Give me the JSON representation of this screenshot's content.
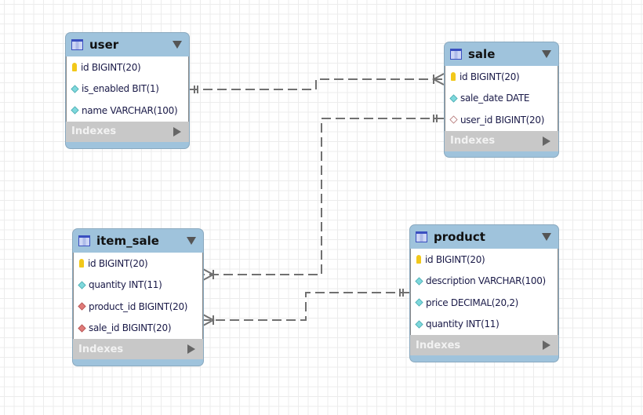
{
  "tables": {
    "user": {
      "name": "user",
      "indexes_label": "Indexes",
      "columns": [
        {
          "text": "id BIGINT(20)",
          "icon": "primary-key-icon"
        },
        {
          "text": "is_enabled BIT(1)",
          "icon": "column-icon"
        },
        {
          "text": "name VARCHAR(100)",
          "icon": "column-icon"
        }
      ]
    },
    "sale": {
      "name": "sale",
      "indexes_label": "Indexes",
      "columns": [
        {
          "text": "id BIGINT(20)",
          "icon": "primary-key-icon"
        },
        {
          "text": "sale_date DATE",
          "icon": "column-icon"
        },
        {
          "text": "user_id BIGINT(20)",
          "icon": "nullable-foreign-key-icon"
        }
      ]
    },
    "item_sale": {
      "name": "item_sale",
      "indexes_label": "Indexes",
      "columns": [
        {
          "text": "id BIGINT(20)",
          "icon": "primary-key-icon"
        },
        {
          "text": "quantity INT(11)",
          "icon": "column-icon"
        },
        {
          "text": "product_id BIGINT(20)",
          "icon": "foreign-key-icon"
        },
        {
          "text": "sale_id BIGINT(20)",
          "icon": "foreign-key-icon"
        }
      ]
    },
    "product": {
      "name": "product",
      "indexes_label": "Indexes",
      "columns": [
        {
          "text": "id BIGINT(20)",
          "icon": "primary-key-icon"
        },
        {
          "text": "description VARCHAR(100)",
          "icon": "column-icon"
        },
        {
          "text": "price DECIMAL(20,2)",
          "icon": "column-icon"
        },
        {
          "text": "quantity INT(11)",
          "icon": "column-icon"
        }
      ]
    }
  },
  "relationships": [
    {
      "from": "user",
      "to": "sale",
      "type": "one-to-many"
    },
    {
      "from": "sale",
      "to": "item_sale",
      "type": "one-to-many"
    },
    {
      "from": "product",
      "to": "item_sale",
      "type": "one-to-many"
    }
  ],
  "colors": {
    "header": "#9fc3dc",
    "indexes": "#c8c8c8",
    "connector": "#707070"
  }
}
